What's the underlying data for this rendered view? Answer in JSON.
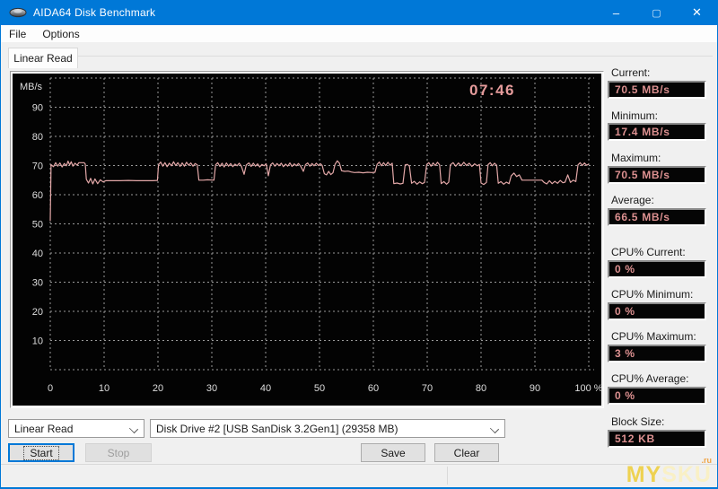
{
  "window": {
    "title": "AIDA64 Disk Benchmark"
  },
  "titlebar_icons": {
    "minimize": "–",
    "maximize": "▢",
    "close": "✕"
  },
  "menu": {
    "items": [
      "File",
      "Options"
    ]
  },
  "tab": {
    "label": "Linear Read"
  },
  "chart_data": {
    "type": "line",
    "title": "Linear Read disk benchmark",
    "y_axis_title": "MB/s",
    "elapsed_time": "07:46",
    "grid": true,
    "xlim": [
      0,
      100
    ],
    "ylim": [
      0,
      100
    ],
    "x_ticks": [
      {
        "v": 0,
        "label": "0"
      },
      {
        "v": 10,
        "label": "10"
      },
      {
        "v": 20,
        "label": "20"
      },
      {
        "v": 30,
        "label": "30"
      },
      {
        "v": 40,
        "label": "40"
      },
      {
        "v": 50,
        "label": "50"
      },
      {
        "v": 60,
        "label": "60"
      },
      {
        "v": 70,
        "label": "70"
      },
      {
        "v": 80,
        "label": "80"
      },
      {
        "v": 90,
        "label": "90"
      },
      {
        "v": 100,
        "label": "100 %"
      }
    ],
    "y_ticks": [
      {
        "v": 10,
        "label": "10"
      },
      {
        "v": 20,
        "label": "20"
      },
      {
        "v": 30,
        "label": "30"
      },
      {
        "v": 40,
        "label": "40"
      },
      {
        "v": 50,
        "label": "50"
      },
      {
        "v": 60,
        "label": "60"
      },
      {
        "v": 70,
        "label": "70"
      },
      {
        "v": 80,
        "label": "80"
      },
      {
        "v": 90,
        "label": "90"
      }
    ],
    "line_color": "#e3a8a8",
    "grid_color": "#9a9a9a",
    "points": [
      [
        0,
        51
      ],
      [
        0.15,
        70.3
      ],
      [
        0.6,
        69.6
      ],
      [
        1,
        71
      ],
      [
        1.4,
        69.8
      ],
      [
        1.8,
        70.9
      ],
      [
        2.2,
        69.5
      ],
      [
        2.6,
        70.7
      ],
      [
        3,
        69.9
      ],
      [
        3.3,
        71.5
      ],
      [
        3.6,
        70.2
      ],
      [
        3.9,
        71.3
      ],
      [
        4.2,
        69.8
      ],
      [
        4.6,
        70.8
      ],
      [
        5,
        70.1
      ],
      [
        5.3,
        71
      ],
      [
        6.3,
        71
      ],
      [
        6.5,
        70.5
      ],
      [
        6.7,
        65.3
      ],
      [
        7.1,
        64
      ],
      [
        7.5,
        65.6
      ],
      [
        7.9,
        63.7
      ],
      [
        8.3,
        65.4
      ],
      [
        8.8,
        63.8
      ],
      [
        9.3,
        65.1
      ],
      [
        9.8,
        64.4
      ],
      [
        10.3,
        64.8
      ],
      [
        11.5,
        64.8
      ],
      [
        13,
        64.8
      ],
      [
        14.5,
        64.9
      ],
      [
        16,
        64.8
      ],
      [
        17.5,
        64.8
      ],
      [
        19,
        64.8
      ],
      [
        19.9,
        64.9
      ],
      [
        20.1,
        70.2
      ],
      [
        20.5,
        71.2
      ],
      [
        20.9,
        69.8
      ],
      [
        21.3,
        71
      ],
      [
        21.7,
        69.6
      ],
      [
        22.1,
        70.8
      ],
      [
        22.5,
        69.9
      ],
      [
        22.9,
        71.3
      ],
      [
        23.3,
        70
      ],
      [
        23.7,
        71
      ],
      [
        24.1,
        69.7
      ],
      [
        24.5,
        70.9
      ],
      [
        24.9,
        69.8
      ],
      [
        25.3,
        71.1
      ],
      [
        25.7,
        70.1
      ],
      [
        26.1,
        70.9
      ],
      [
        26.5,
        69.8
      ],
      [
        26.9,
        70.7
      ],
      [
        27.3,
        70.2
      ],
      [
        27.6,
        65
      ],
      [
        28.4,
        65
      ],
      [
        29.2,
        65.1
      ],
      [
        30.4,
        65
      ],
      [
        30.7,
        70.2
      ],
      [
        31.1,
        71
      ],
      [
        31.5,
        69.7
      ],
      [
        31.9,
        70.8
      ],
      [
        32.3,
        69.5
      ],
      [
        32.7,
        70.9
      ],
      [
        33.1,
        69.8
      ],
      [
        33.5,
        70.7
      ],
      [
        33.9,
        69.6
      ],
      [
        34.3,
        70.5
      ],
      [
        34.7,
        69.9
      ],
      [
        35.1,
        70.8
      ],
      [
        35.5,
        69.7
      ],
      [
        36,
        67
      ],
      [
        36.4,
        70.2
      ],
      [
        36.9,
        70.9
      ],
      [
        37.3,
        69.7
      ],
      [
        37.7,
        70.8
      ],
      [
        38.1,
        69.8
      ],
      [
        38.5,
        70.6
      ],
      [
        38.9,
        69.5
      ],
      [
        39.3,
        70.4
      ],
      [
        39.7,
        69.9
      ],
      [
        40.1,
        70.6
      ],
      [
        40.5,
        66.5
      ],
      [
        40.9,
        70.2
      ],
      [
        41.3,
        70.9
      ],
      [
        41.7,
        69.8
      ],
      [
        42.1,
        70.7
      ],
      [
        42.5,
        69.9
      ],
      [
        42.9,
        70.8
      ],
      [
        43.3,
        69.6
      ],
      [
        43.7,
        70.5
      ],
      [
        44.1,
        69.8
      ],
      [
        44.5,
        70.9
      ],
      [
        44.9,
        69.7
      ],
      [
        45.3,
        70.6
      ],
      [
        45.7,
        69.9
      ],
      [
        46.1,
        70.7
      ],
      [
        46.5,
        69.8
      ],
      [
        47,
        68
      ],
      [
        47.4,
        70.3
      ],
      [
        47.8,
        70.9
      ],
      [
        48.2,
        69.8
      ],
      [
        48.6,
        70.7
      ],
      [
        49,
        69.9
      ],
      [
        49.4,
        70.8
      ],
      [
        49.8,
        70
      ],
      [
        50.2,
        70.6
      ],
      [
        50.5,
        70
      ],
      [
        50.9,
        67.2
      ],
      [
        51.3,
        66.8
      ],
      [
        51.7,
        68
      ],
      [
        52.1,
        66.9
      ],
      [
        52.5,
        67.5
      ],
      [
        52.9,
        70.5
      ],
      [
        53.3,
        71.6
      ],
      [
        53.7,
        70.8
      ],
      [
        54.1,
        68.2
      ],
      [
        54.7,
        68
      ],
      [
        55.3,
        68.1
      ],
      [
        55.9,
        67.8
      ],
      [
        56.5,
        67.6
      ],
      [
        57.3,
        67.7
      ],
      [
        58.1,
        67.5
      ],
      [
        58.9,
        67.7
      ],
      [
        59.7,
        67.6
      ],
      [
        60.3,
        67.7
      ],
      [
        60.7,
        70.4
      ],
      [
        61.1,
        71.2
      ],
      [
        61.5,
        69.9
      ],
      [
        61.9,
        71
      ],
      [
        62.3,
        70
      ],
      [
        62.7,
        71.1
      ],
      [
        63.1,
        70.1
      ],
      [
        63.5,
        70.8
      ],
      [
        63.8,
        63.8
      ],
      [
        64.4,
        64
      ],
      [
        65,
        63.7
      ],
      [
        65.5,
        63.9
      ],
      [
        65.9,
        70.2
      ],
      [
        66.3,
        70.4
      ],
      [
        66.7,
        69.8
      ],
      [
        67.1,
        63.9
      ],
      [
        67.6,
        64.6
      ],
      [
        68.1,
        63.6
      ],
      [
        68.6,
        64.4
      ],
      [
        69.1,
        63.8
      ],
      [
        69.5,
        64.2
      ],
      [
        69.9,
        70.3
      ],
      [
        70.3,
        71
      ],
      [
        70.7,
        69.8
      ],
      [
        71.1,
        70.9
      ],
      [
        71.5,
        70
      ],
      [
        71.9,
        71.1
      ],
      [
        72.3,
        70.2
      ],
      [
        72.6,
        63.8
      ],
      [
        73.1,
        64.5
      ],
      [
        73.6,
        63.6
      ],
      [
        74,
        64.3
      ],
      [
        74.3,
        70.2
      ],
      [
        74.8,
        71
      ],
      [
        75.3,
        69.8
      ],
      [
        75.8,
        70.9
      ],
      [
        76.3,
        69.9
      ],
      [
        76.8,
        71.1
      ],
      [
        77.3,
        70
      ],
      [
        77.8,
        70.8
      ],
      [
        78.3,
        69.7
      ],
      [
        78.8,
        70.6
      ],
      [
        79.3,
        69.9
      ],
      [
        79.7,
        70.4
      ],
      [
        80,
        64
      ],
      [
        80.5,
        63.5
      ],
      [
        81,
        64.2
      ],
      [
        81.3,
        70.3
      ],
      [
        81.7,
        71
      ],
      [
        82.1,
        69.9
      ],
      [
        82.5,
        70.8
      ],
      [
        82.9,
        70.1
      ],
      [
        83.2,
        63.9
      ],
      [
        83.7,
        64.5
      ],
      [
        84.2,
        63.6
      ],
      [
        84.7,
        64.3
      ],
      [
        85.2,
        63.8
      ],
      [
        85.6,
        66.5
      ],
      [
        86.1,
        67.4
      ],
      [
        86.6,
        66.2
      ],
      [
        87.1,
        66.8
      ],
      [
        87.6,
        65
      ],
      [
        88.6,
        65
      ],
      [
        89.6,
        65
      ],
      [
        90.6,
        65
      ],
      [
        91.3,
        65
      ],
      [
        91.7,
        64.2
      ],
      [
        92.2,
        63.7
      ],
      [
        92.7,
        64.8
      ],
      [
        93.2,
        63.8
      ],
      [
        93.7,
        64.6
      ],
      [
        94.2,
        63.9
      ],
      [
        94.7,
        64.9
      ],
      [
        95.2,
        64.1
      ],
      [
        95.6,
        64.3
      ],
      [
        96.1,
        66.8
      ],
      [
        96.6,
        64.2
      ],
      [
        97.1,
        65
      ],
      [
        97.6,
        64.5
      ],
      [
        98,
        70.2
      ],
      [
        98.4,
        71
      ],
      [
        98.8,
        70
      ],
      [
        99.2,
        70.9
      ],
      [
        99.6,
        70.1
      ],
      [
        100,
        70.5
      ]
    ]
  },
  "stats": {
    "items": [
      {
        "id": "current",
        "label": "Current:",
        "value": "70.5 MB/s"
      },
      {
        "id": "minimum",
        "label": "Minimum:",
        "value": "17.4 MB/s"
      },
      {
        "id": "maximum",
        "label": "Maximum:",
        "value": "70.5 MB/s"
      },
      {
        "id": "average",
        "label": "Average:",
        "value": "66.5 MB/s"
      },
      {
        "id": "cpu-current",
        "label": "CPU% Current:",
        "value": "0 %"
      },
      {
        "id": "cpu-minimum",
        "label": "CPU% Minimum:",
        "value": "0 %"
      },
      {
        "id": "cpu-maximum",
        "label": "CPU% Maximum:",
        "value": "3 %"
      },
      {
        "id": "cpu-average",
        "label": "CPU% Average:",
        "value": "0 %"
      },
      {
        "id": "block-size",
        "label": "Block Size:",
        "value": "512 KB"
      }
    ]
  },
  "controls": {
    "benchmark_type": {
      "value": "Linear Read"
    },
    "disk_drive": {
      "value": "Disk Drive #2  [USB SanDisk 3.2Gen1]  (29358 MB)"
    },
    "buttons": {
      "start": "Start",
      "stop": "Stop",
      "save": "Save",
      "clear": "Clear"
    }
  },
  "watermark": {
    "part1": "MY",
    "part2": "SKU",
    "suffix": ".ru"
  },
  "colors": {
    "titlebar": "#0078d7",
    "value_text": "#dc9090",
    "chart_bg": "#030303"
  }
}
